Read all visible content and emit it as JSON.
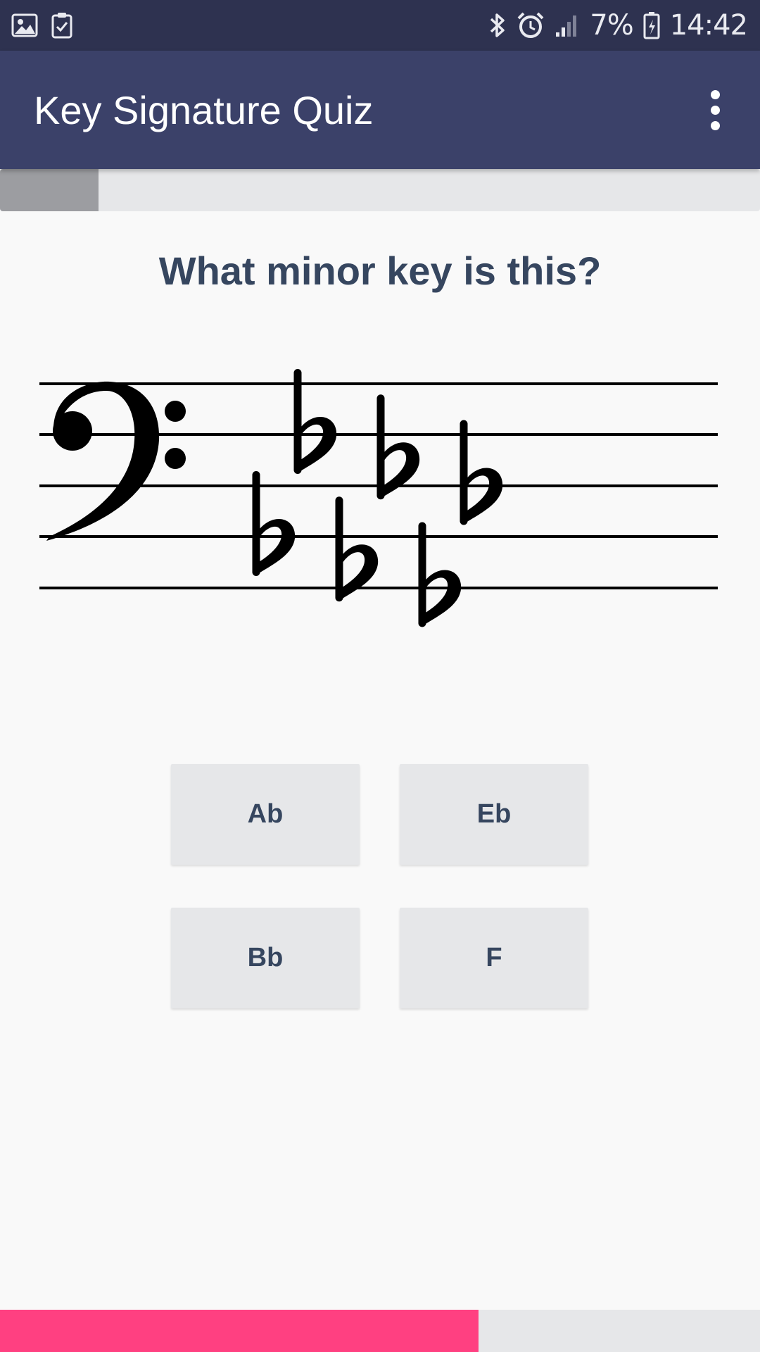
{
  "status_bar": {
    "left_icons": [
      "image-icon",
      "clipboard-check-icon"
    ],
    "right_icons": [
      "bluetooth-icon",
      "alarm-icon",
      "signal-icon",
      "battery-icon"
    ],
    "battery_text": "7%",
    "time": "14:42"
  },
  "app_bar": {
    "title": "Key Signature Quiz",
    "menu_icon": "more-vert-icon"
  },
  "quiz_progress": {
    "fraction": 0.13
  },
  "question": "What minor key is this?",
  "staff": {
    "clef": "bass",
    "accidental": "flat",
    "flat_count": 6
  },
  "answers": [
    {
      "label": "Ab"
    },
    {
      "label": "Eb"
    },
    {
      "label": "Bb"
    },
    {
      "label": "F"
    }
  ],
  "timer_progress": {
    "fraction": 0.63
  },
  "colors": {
    "status_bar": "#2e3250",
    "app_bar": "#3b4169",
    "text_primary": "#36465f",
    "timer_accent": "#ff4081",
    "button_bg": "#e6e7e9"
  }
}
